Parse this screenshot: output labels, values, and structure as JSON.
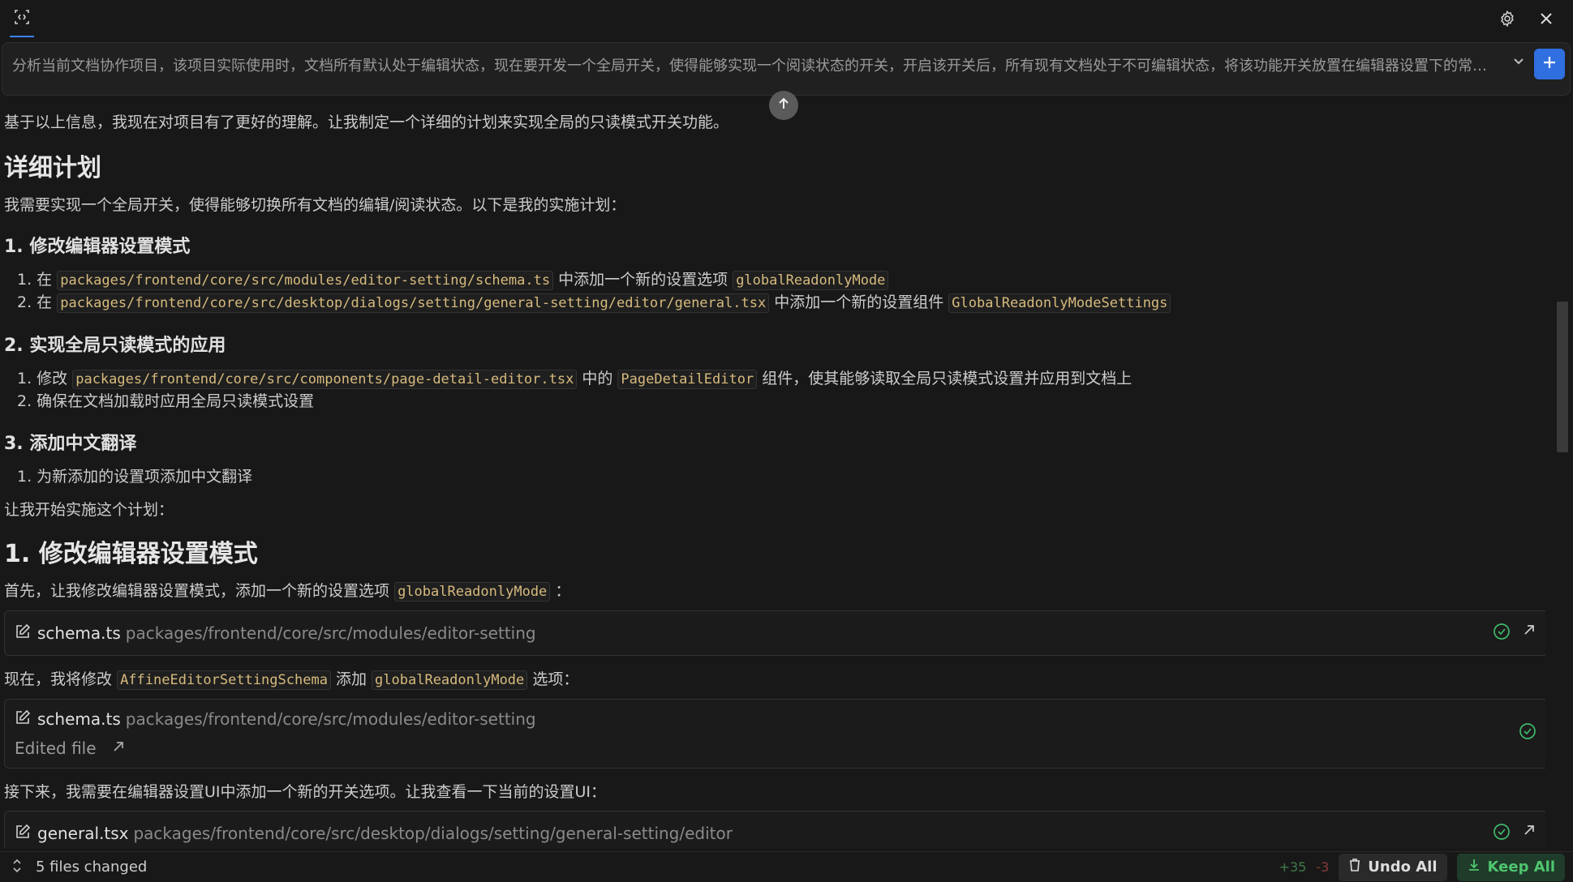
{
  "topbar": {
    "left_icon": "code-selection-icon",
    "settings_icon": "gear-icon",
    "close_icon": "close-icon"
  },
  "query": {
    "text": "分析当前文档协作项目，该项目实际使用时，文档所有默认处于编辑状态，现在要开发一个全局开关，使得能够实现一个阅读状态的开关，开启该开关后，所有现有文档处于不可编辑状态，将该功能开关放置在编辑器设置下的常规..."
  },
  "content": {
    "intro": "基于以上信息，我现在对项目有了更好的理解。让我制定一个详细的计划来实现全局的只读模式开关功能。",
    "plan_title": "详细计划",
    "plan_desc": "我需要实现一个全局开关，使得能够切换所有文档的编辑/阅读状态。以下是我的实施计划：",
    "s1_title": "1. 修改编辑器设置模式",
    "s1_i1_pre": "1. 在",
    "s1_i1_code1": "packages/frontend/core/src/modules/editor-setting/schema.ts",
    "s1_i1_mid": "中添加一个新的设置选项",
    "s1_i1_code2": "globalReadonlyMode",
    "s1_i2_pre": "2. 在",
    "s1_i2_code1": "packages/frontend/core/src/desktop/dialogs/setting/general-setting/editor/general.tsx",
    "s1_i2_mid": "中添加一个新的设置组件",
    "s1_i2_code2": "GlobalReadonlyModeSettings",
    "s2_title": "2. 实现全局只读模式的应用",
    "s2_i1_pre": "1. 修改",
    "s2_i1_code1": "packages/frontend/core/src/components/page-detail-editor.tsx",
    "s2_i1_mid": "中的",
    "s2_i1_code2": "PageDetailEditor",
    "s2_i1_post": "组件，使其能够读取全局只读模式设置并应用到文档上",
    "s2_i2": "2. 确保在文档加载时应用全局只读模式设置",
    "s3_title": "3. 添加中文翻译",
    "s3_i1": "1. 为新添加的设置项添加中文翻译",
    "start": "让我开始实施这个计划：",
    "h1_1": "1. 修改编辑器设置模式",
    "first_pre": "首先，让我修改编辑器设置模式，添加一个新的设置选项",
    "first_code": "globalReadonlyMode",
    "first_post": "：",
    "card1_name": "schema.ts",
    "card1_path": "packages/frontend/core/src/modules/editor-setting",
    "now_pre": "现在，我将修改",
    "now_code1": "AffineEditorSettingSchema",
    "now_mid": "添加",
    "now_code2": "globalReadonlyMode",
    "now_post": "选项：",
    "card2_name": "schema.ts",
    "card2_path": "packages/frontend/core/src/modules/editor-setting",
    "card2_status": "Edited file",
    "next": "接下来，我需要在编辑器设置UI中添加一个新的开关选项。让我查看一下当前的设置UI：",
    "card3_name": "general.tsx",
    "card3_path": "packages/frontend/core/src/desktop/dialogs/setting/general-setting/editor"
  },
  "bottom": {
    "files_changed": "5 files changed",
    "added": "+35",
    "removed": "-3",
    "undo_label": "Undo All",
    "keep_label": "Keep All"
  }
}
